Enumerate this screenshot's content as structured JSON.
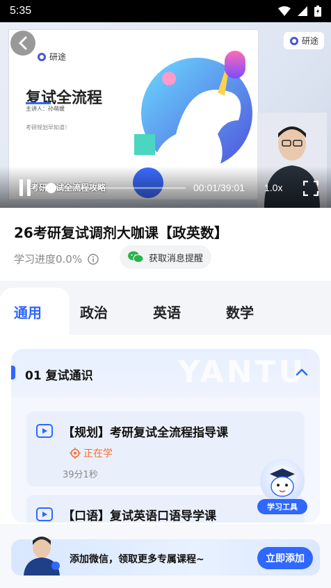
{
  "status_bar": {
    "time": "5:35"
  },
  "video": {
    "slide_brand": "研途",
    "slide_title": "复试全流程",
    "slide_lecturer": "主讲人：孙萌媛",
    "slide_note": "考研规划早知道！",
    "watermark_brand": "研途",
    "chapter_title": "考研复试全流程攻略",
    "time": "00:01/39:01",
    "speed": "1.0x",
    "progress_fraction": 0.0004
  },
  "course": {
    "title": "26考研复试调剂大咖课【政英数】",
    "progress": "学习进度0.0%",
    "remind_label": "获取消息提醒"
  },
  "tabs": [
    {
      "label": "通用",
      "active": true
    },
    {
      "label": "政治",
      "active": false
    },
    {
      "label": "英语",
      "active": false
    },
    {
      "label": "数学",
      "active": false
    }
  ],
  "section": {
    "title": "01  复试通识",
    "watermark": "YANTU",
    "lessons": [
      {
        "name": "【规划】考研复试全流程指导课",
        "status": "正在学",
        "duration": "39分1秒"
      },
      {
        "name": "【口语】复试英语口语导学课"
      }
    ]
  },
  "tools_button": {
    "label": "学习工具"
  },
  "banner": {
    "text": "添加微信，领取更多专属课程~",
    "button": "立即添加"
  },
  "colors": {
    "accent": "#2f67ff",
    "learning": "#ff6a2a"
  }
}
